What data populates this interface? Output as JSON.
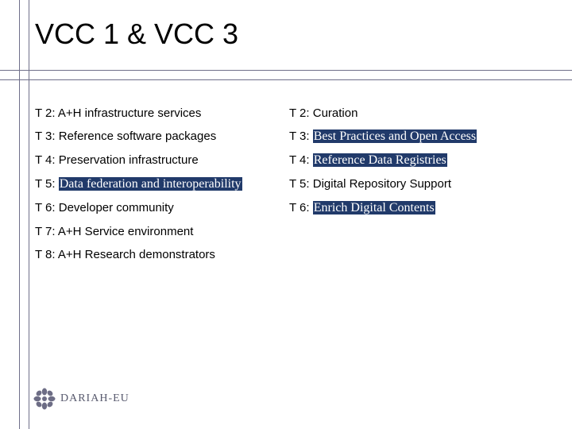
{
  "title": "VCC 1 & VCC 3",
  "left": [
    {
      "prefix": "T 2: ",
      "text": "A+H infrastructure services",
      "highlighted": false
    },
    {
      "prefix": "T 3: ",
      "text": "Reference software packages",
      "highlighted": false
    },
    {
      "prefix": "T 4: ",
      "text": "Preservation infrastructure",
      "highlighted": false
    },
    {
      "prefix": "T 5: ",
      "text": "Data federation and interoperability",
      "highlighted": true
    },
    {
      "prefix": "T 6: ",
      "text": "Developer community",
      "highlighted": false
    },
    {
      "prefix": "T 7: ",
      "text": "A+H Service environment",
      "highlighted": false
    },
    {
      "prefix": "T 8: ",
      "text": "A+H Research demonstrators",
      "highlighted": false
    }
  ],
  "right": [
    {
      "prefix": "T 2: ",
      "text": "Curation",
      "highlighted": false
    },
    {
      "prefix": "T 3: ",
      "text": "Best Practices and Open Access",
      "highlighted": true
    },
    {
      "prefix": "T 4: ",
      "text": "Reference Data Registries",
      "highlighted": true
    },
    {
      "prefix": "T 5: ",
      "text": "Digital Repository Support",
      "highlighted": false
    },
    {
      "prefix": "T 6: ",
      "text": "Enrich Digital Contents",
      "highlighted": true
    }
  ],
  "logo_text": "DARIAH-EU"
}
